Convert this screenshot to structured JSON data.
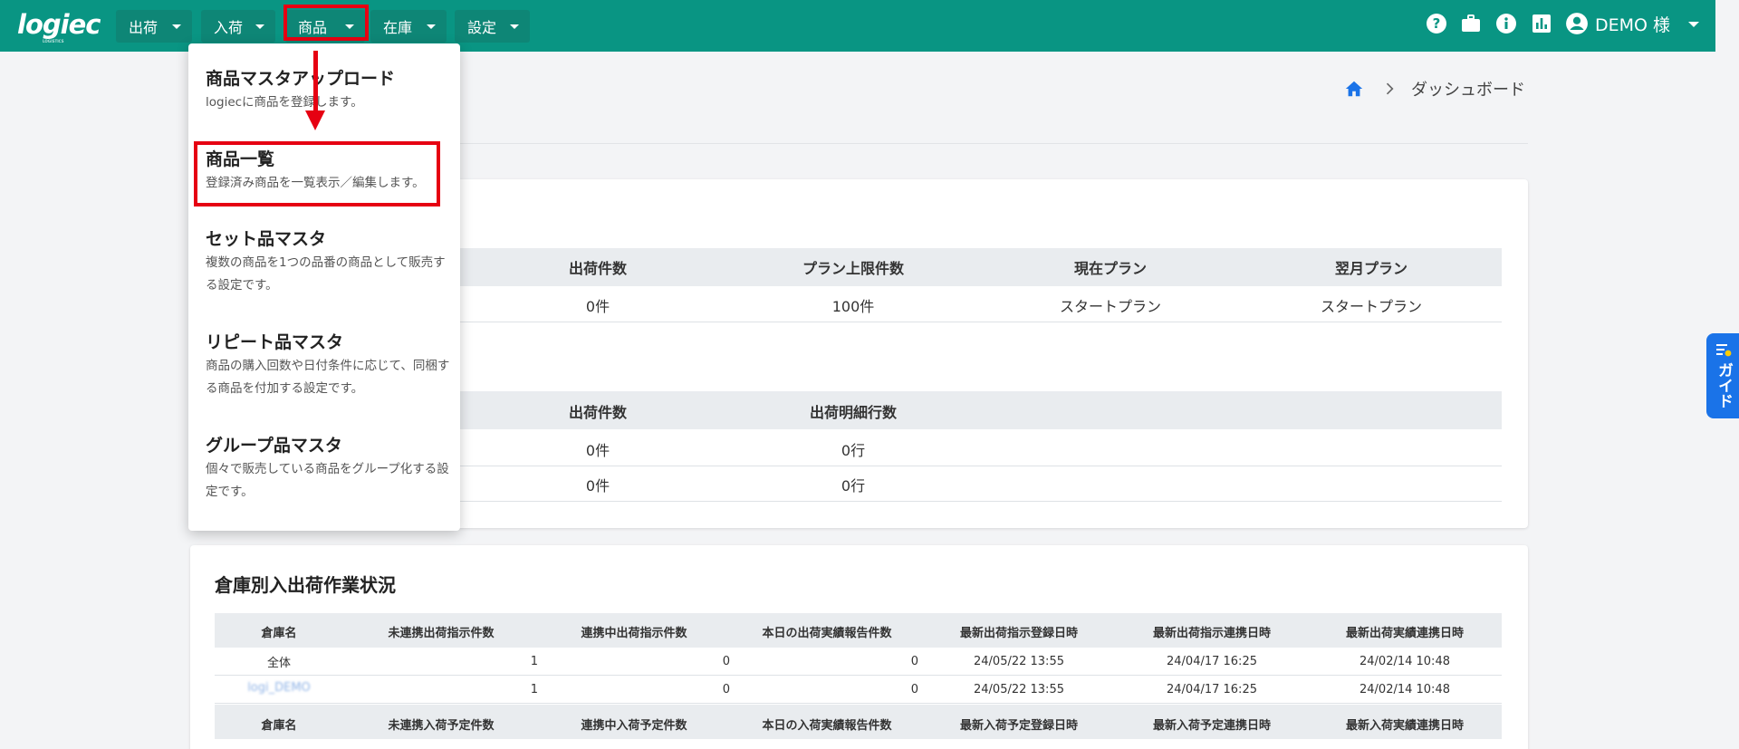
{
  "header": {
    "logo": "logiec",
    "logo_sub": "LOGISTICS",
    "nav": [
      "出荷",
      "入荷",
      "商品",
      "在庫",
      "設定"
    ],
    "user_name": "DEMO 様",
    "icons": [
      "help-icon",
      "briefcase-icon",
      "info-icon",
      "chart-icon",
      "account-icon"
    ]
  },
  "breadcrumb": {
    "current": "ダッシュボード"
  },
  "menu": {
    "items": [
      {
        "title": "商品マスタアップロード",
        "desc": "logiecに商品を登録します。"
      },
      {
        "title": "商品一覧",
        "desc": "登録済み商品を一覧表示／編集します。"
      },
      {
        "title": "セット品マスタ",
        "desc": "複数の商品を1つの品番の商品として販売する設定です。"
      },
      {
        "title": "リピート品マスタ",
        "desc": "商品の購入回数や日付条件に応じて、同梱する商品を付加する設定です。"
      },
      {
        "title": "グループ品マスタ",
        "desc": "個々で販売している商品をグループ化する設定です。"
      }
    ]
  },
  "plan_table": {
    "headers": [
      "出荷件数",
      "プラン上限件数",
      "現在プラン",
      "翌月プラン"
    ],
    "row": [
      "0件",
      "100件",
      "スタートプラン",
      "スタートプラン"
    ]
  },
  "ship_table": {
    "headers": [
      "出荷件数",
      "出荷明細行数"
    ],
    "rows": [
      [
        "0件",
        "0行"
      ],
      [
        "0件",
        "0行"
      ]
    ]
  },
  "warehouse": {
    "title": "倉庫別入出荷作業状況",
    "ship_headers": [
      "倉庫名",
      "未連携出荷指示件数",
      "連携中出荷指示件数",
      "本日の出荷実績報告件数",
      "最新出荷指示登録日時",
      "最新出荷指示連携日時",
      "最新出荷実績連携日時"
    ],
    "ship_rows": [
      [
        "全体",
        "1",
        "0",
        "0",
        "24/05/22 13:55",
        "24/04/17 16:25",
        "24/02/14 10:48"
      ],
      [
        "logi_DEMO",
        "1",
        "0",
        "0",
        "24/05/22 13:55",
        "24/04/17 16:25",
        "24/02/14 10:48"
      ]
    ],
    "recv_headers": [
      "倉庫名",
      "未連携入荷予定件数",
      "連携中入荷予定件数",
      "本日の入荷実績報告件数",
      "最新入荷予定登録日時",
      "最新入荷予定連携日時",
      "最新入荷実績連携日時"
    ]
  },
  "guide": {
    "label": "ガイド"
  },
  "colors": {
    "header": "#099583",
    "accent": "#1a73e8",
    "highlight": "#e60012"
  }
}
